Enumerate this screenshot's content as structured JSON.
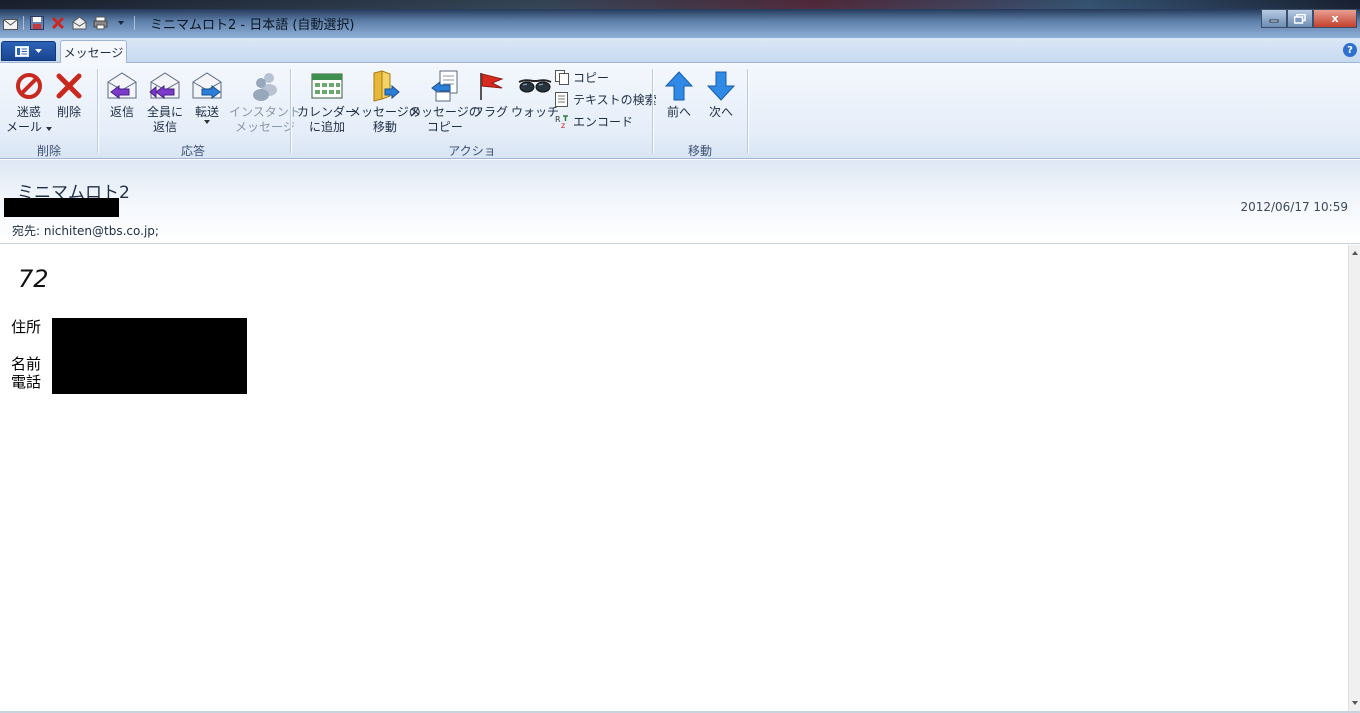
{
  "window": {
    "title": "ミニマムロト2 - 日本語 (自動選択)",
    "controls": {
      "minimize": "‒",
      "maximize": "▢",
      "close": "x"
    }
  },
  "tabs": [
    {
      "label": "メッセージ",
      "active": true
    }
  ],
  "ribbon": {
    "groups": {
      "delete": "削除",
      "respond": "応答",
      "actions": "アクション",
      "move": "移動"
    },
    "buttons": {
      "junk_line1": "迷惑",
      "junk_line2": "メール",
      "delete": "削除",
      "reply": "返信",
      "reply_all_line1": "全員に",
      "reply_all_line2": "返信",
      "forward": "転送",
      "im_line1": "インスタント",
      "im_line2": "メッセージ",
      "calendar_line1": "カレンダー",
      "calendar_line2": "に追加",
      "move_line1": "メッセージの",
      "move_line2": "移動",
      "copymsg_line1": "メッセージの",
      "copymsg_line2": "コピー",
      "flag": "フラグ",
      "watch": "ウォッチ",
      "copy": "コピー",
      "find_text": "テキストの検索",
      "encode": "エンコード",
      "previous": "前へ",
      "next": "次へ"
    }
  },
  "message": {
    "subject": "ミニマムロト2",
    "date": "2012/06/17 10:59",
    "to": "宛先: nichiten@tbs.co.jp;",
    "body": {
      "number": "72",
      "address_label": "住所",
      "name_label": "名前",
      "phone_label": "電話"
    }
  },
  "colors": {
    "ribbon_bg": "#e6eef9",
    "accent_blue": "#2e6fcf",
    "close_red": "#c2402c",
    "redaction": "#000000"
  }
}
